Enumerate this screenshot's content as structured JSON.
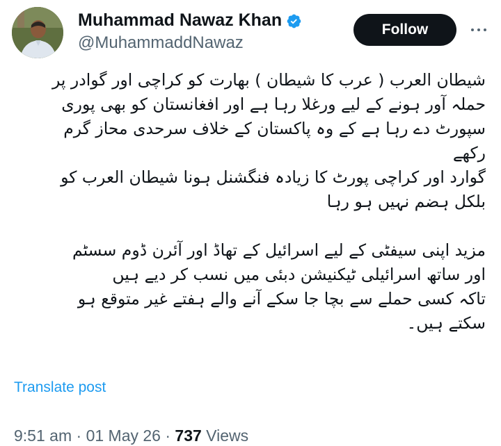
{
  "author": {
    "display_name": "Muhammad Nawaz Khan",
    "handle": "@MuhammaddNawaz",
    "verified": true,
    "verified_icon": "verified-badge-icon",
    "avatar_icon": "avatar"
  },
  "actions": {
    "follow_label": "Follow",
    "more_icon": "more-options-icon"
  },
  "post": {
    "lines": [
      "شیطان العرب ( عرب کا شیطان ) بھارت  کو کراچی اور گوادر پر",
      "حملہ آور ہونے کے لیے ورغلا رہا ہے اور افغانستان کو بھی پوری",
      "سپورٹ دے رہا ہے کے وہ پاکستان کے خلاف سرحدی محاز گرم",
      "رکھے",
      "گوارد اور کراچی پورٹ کا زیادہ فنگشنل ہونا شیطان العرب کو",
      "بلکل ہضم نہیں ہو رہا",
      "",
      "مزید اپنی سیفٹی کے لیے اسرائیل کے تھاڈ اور آئرن ڈوم سسٹم",
      "اور ساتھ اسرائیلی ٹیکنیشن  دبئی میں نسب کر دیے ہیں",
      "تاکہ کسی حملے سے بچا جا سکے  آنے والے ہفتے غیر متوقع ہو",
      "سکتے ہیں۔"
    ]
  },
  "translate_label": "Translate post",
  "meta": {
    "time": "9:51 am",
    "separator": " · ",
    "date": "01 May 26",
    "views_count": "737",
    "views_label": " Views"
  },
  "colors": {
    "accent": "#1d9bf0",
    "text": "#0f1419",
    "secondary": "#536471",
    "follow_bg": "#0f1419"
  }
}
